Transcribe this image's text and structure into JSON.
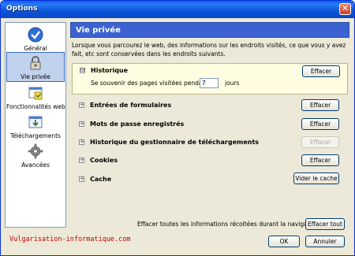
{
  "window": {
    "title": "Options"
  },
  "sidebar": {
    "items": [
      {
        "label": "Général",
        "icon": "checkmark-icon",
        "selected": false
      },
      {
        "label": "Vie privée",
        "icon": "padlock-icon",
        "selected": true
      },
      {
        "label": "Fonctionnalités web",
        "icon": "web-features-icon",
        "selected": false
      },
      {
        "label": "Téléchargements",
        "icon": "downloads-icon",
        "selected": false
      },
      {
        "label": "Avancées",
        "icon": "gear-icon",
        "selected": false
      }
    ]
  },
  "panel": {
    "title": "Vie privée",
    "description": "Lorsque vous parcourez le web, des informations sur les endroits visités, ce que vous y avez fait, etc sont conservées dans les endroits suivants.",
    "sections": [
      {
        "label": "Historique",
        "expanded": true,
        "expander": "⊟",
        "button": "Effacer",
        "enabled": true
      },
      {
        "label": "Entrées de formulaires",
        "expander": "+",
        "button": "Effacer",
        "enabled": true
      },
      {
        "label": "Mots de passe enregistrés",
        "expander": "+",
        "button": "Effacer",
        "enabled": true
      },
      {
        "label": "Historique du gestionnaire de téléchargements",
        "expander": "+",
        "button": "Effacer",
        "enabled": false
      },
      {
        "label": "Cookies",
        "expander": "+",
        "button": "Effacer",
        "enabled": true
      },
      {
        "label": "Cache",
        "expander": "+",
        "button": "Vider le cache",
        "enabled": true
      }
    ],
    "history": {
      "remember_label": "Se souvenir des pages visitées pendant",
      "days_value": "7",
      "days_unit": "jours"
    }
  },
  "footer": {
    "clear_all_label": "Effacer toutes les informations récoltées durant la navigation :",
    "clear_all_button": "Effacer tout",
    "ok_button": "OK",
    "cancel_button": "Annuler",
    "watermark": "Vulgarisation-informatique.com"
  },
  "colors": {
    "titlebar": "#0a5ef0",
    "panel_header": "#3b62d0",
    "history_bg": "#fffde1",
    "watermark": "#c40000"
  }
}
